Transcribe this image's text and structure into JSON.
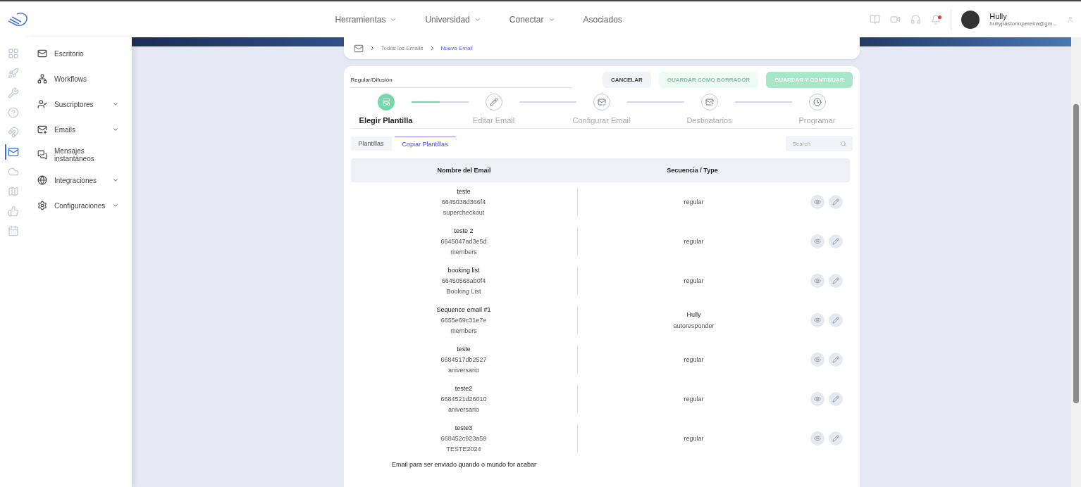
{
  "nav": [
    {
      "label": "Herramientas",
      "has_menu": true
    },
    {
      "label": "Universidad",
      "has_menu": true
    },
    {
      "label": "Conectar",
      "has_menu": true
    },
    {
      "label": "Asociados",
      "has_menu": false
    }
  ],
  "user": {
    "name": "Hully",
    "email": "hullypastoriopereira@gm...",
    "unread": true
  },
  "rail": [
    {
      "selected": false
    },
    {
      "selected": false
    },
    {
      "selected": false
    },
    {
      "selected": false
    },
    {
      "selected": false
    },
    {
      "selected": true
    },
    {
      "selected": false
    },
    {
      "selected": false
    },
    {
      "selected": false
    },
    {
      "selected": false
    }
  ],
  "sidebar": {
    "items": [
      {
        "label": "Escritorio",
        "has_menu": false
      },
      {
        "label": "Workflows",
        "has_menu": false
      },
      {
        "label": "Suscriptores",
        "has_menu": true
      },
      {
        "label": "Emails",
        "has_menu": true
      },
      {
        "label": "Mensajes instantáneos",
        "has_menu": false
      },
      {
        "label": "Integraciones",
        "has_menu": true
      },
      {
        "label": "Configuraciones",
        "has_menu": true
      }
    ]
  },
  "breadcrumb": [
    {
      "label": "Todos los Emails",
      "selected": false
    },
    {
      "label": "Nuevo Email",
      "selected": true
    }
  ],
  "email_type": {
    "value": "Regular/Difusión"
  },
  "buttons": [
    {
      "label": "CANCELAR",
      "kind": "secondary",
      "disabled": false
    },
    {
      "label": "GUARDAR COMO BORRADOR",
      "kind": "draft",
      "disabled": true
    },
    {
      "label": "GUARDAR Y CONTINUAR",
      "kind": "primary",
      "disabled": true
    }
  ],
  "steps": [
    {
      "label": "Elegir Plantilla",
      "selected": true
    },
    {
      "label": "Editar Email",
      "selected": false
    },
    {
      "label": "Configurar Email",
      "selected": false
    },
    {
      "label": "Destinatarios",
      "selected": false
    },
    {
      "label": "Programar",
      "selected": false
    }
  ],
  "step_progress": {
    "level": 0.5
  },
  "tabs": [
    {
      "label": "Plantillas",
      "selected": false
    },
    {
      "label": "Copiar Plantillas",
      "selected": true
    }
  ],
  "search": {
    "placeholder": "Search"
  },
  "table": {
    "columns": [
      "Nombre del Email",
      "Secuencia / Type"
    ],
    "rows": [
      {
        "name": "teste",
        "id": "6645038d366f4",
        "category": "supercheckout",
        "type": "regular"
      },
      {
        "name": "teste 2",
        "id": "6645047ad3e5d",
        "category": "members",
        "type": "regular"
      },
      {
        "name": "booking list",
        "id": "66450568ab0f4",
        "category": "Booking List",
        "type": "regular"
      },
      {
        "name": "Sequence email #1",
        "id": "6655e69c31e7e",
        "category": "members",
        "sequence": "Hully",
        "type": "autoresponder"
      },
      {
        "name": "teste",
        "id": "6684517db2527",
        "category": "aniversario",
        "type": "regular"
      },
      {
        "name": "teste2",
        "id": "6684521d26010",
        "category": "aniversario",
        "type": "regular"
      },
      {
        "name": "teste3",
        "id": "668452c923a59",
        "category": "TESTE2024",
        "type": "regular"
      },
      {
        "name": "Email para ser enviado quando o mundo for acabar"
      }
    ]
  }
}
